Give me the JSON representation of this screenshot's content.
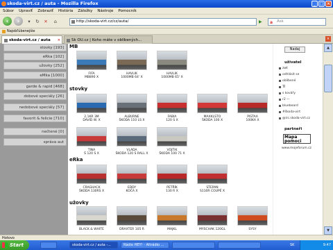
{
  "window": {
    "title": "skoda-virt.cz / auta - Mozilla Firefox"
  },
  "menu": [
    "Súbor",
    "Upraviť",
    "Zobraziť",
    "História",
    "Záložky",
    "Nástroje",
    "Pomocník"
  ],
  "nav": {
    "url": "http://skoda-virt.cz/cz/auta/",
    "search_placeholder": "Ask"
  },
  "bookmarks": [
    "Najobľúbenejšie"
  ],
  "tabs": [
    {
      "label": "skoda-virt.cz / auta"
    },
    {
      "label": "Sk OU.cz | Koho máte v oblíbených..."
    }
  ],
  "left_menu": [
    {
      "label": "stovky [193]"
    },
    {
      "label": "eRka [102]"
    },
    {
      "label": "užovky [252]"
    },
    {
      "label": "eMka [1000]"
    },
    {
      "label": "garde & rapid [468]"
    },
    {
      "label": "dobové speciály [26]"
    },
    {
      "label": "nedobové speciály [57]"
    },
    {
      "label": "favorit & felicie [710]"
    },
    {
      "label": "nečtené [0]"
    },
    {
      "label": "správa aut"
    }
  ],
  "sections": {
    "mb": {
      "title": "MB",
      "items": [
        {
          "caption": "FIFA",
          "sub": "MB890 X",
          "color": "#3a7ab8"
        },
        {
          "caption": "HAVLIK",
          "sub": "1000MB 64' X",
          "color": "#7a6a55"
        },
        {
          "caption": "HAVLIK",
          "sub": "1000MB 65' X",
          "color": "#8a8a80"
        }
      ]
    },
    "stovky": {
      "title": "stovky",
      "items": [
        {
          "caption": "2,1KR 3M",
          "sub": "DAVID W. X",
          "color": "#2a6ab0"
        },
        {
          "caption": "ALBURNE",
          "sub": "ŠKODA 110 LS X",
          "color": "#6a7078"
        },
        {
          "caption": "FABIA",
          "sub": "120 S X",
          "color": "#c83030"
        },
        {
          "caption": "MAXKLSTO",
          "sub": "ŠKODA 100 X",
          "color": "#d23838"
        },
        {
          "caption": "PISTAA",
          "sub": "100KA X",
          "color": "#b82a2a"
        },
        {
          "caption": "TINA",
          "sub": "Š 120 S X",
          "color": "#c83a3a"
        },
        {
          "caption": "VLADA",
          "sub": "ŠKODA 120 S RALL X",
          "color": "#5a6a7a"
        },
        {
          "caption": "VOJTIK",
          "sub": "ŠKODA 100 71 X",
          "color": "#c8c8c0"
        }
      ]
    },
    "erka": {
      "title": "eRka",
      "items": [
        {
          "caption": "CRAGHACK",
          "sub": "ŠKODA 130RS X",
          "color": "#b83030"
        },
        {
          "caption": "EDDY",
          "sub": "KOČA X",
          "color": "#c83a3a"
        },
        {
          "caption": "PETŘÍK",
          "sub": "130 R X",
          "color": "#b82828"
        },
        {
          "caption": "STEPAN",
          "sub": "S110R COUPÉ X",
          "color": "#c03030"
        }
      ]
    },
    "uzovky": {
      "title": "užovky",
      "items": [
        {
          "caption": "BLACK & WHITE",
          "sub": "",
          "color": "#d8d8d0"
        },
        {
          "caption": "DRAXTER 105 R",
          "sub": "",
          "color": "#5a4a3a"
        },
        {
          "caption": "MAJKL",
          "sub": "",
          "color": "#c8782a"
        },
        {
          "caption": "MYSCHAK 120GL",
          "sub": "",
          "color": "#7a3030"
        },
        {
          "caption": "SYSY",
          "sub": "",
          "color": "#d04a20"
        }
      ]
    }
  },
  "right": {
    "button": "Nadaj",
    "users_title": "uživatel",
    "users": [
      "zwt",
      "odhlásit se",
      "oblíbené",
      "Tš",
      "s kovářy",
      "r2 —",
      "bluebeard",
      "#škoda-virt",
      "@irc.skoda-virt.cz"
    ],
    "partners_title": "partneři",
    "partner_logo": "Mapa pomoci",
    "partner_url": "www.mojeforum.cz"
  },
  "status": "Hotovo",
  "taskbar": {
    "start": "Start",
    "tasks": [
      "skoda-virt.cz / auta -...",
      "Rádio HEY! - Altrádio ...",
      "",
      ""
    ],
    "clock": "9:47",
    "lang": "SK"
  }
}
